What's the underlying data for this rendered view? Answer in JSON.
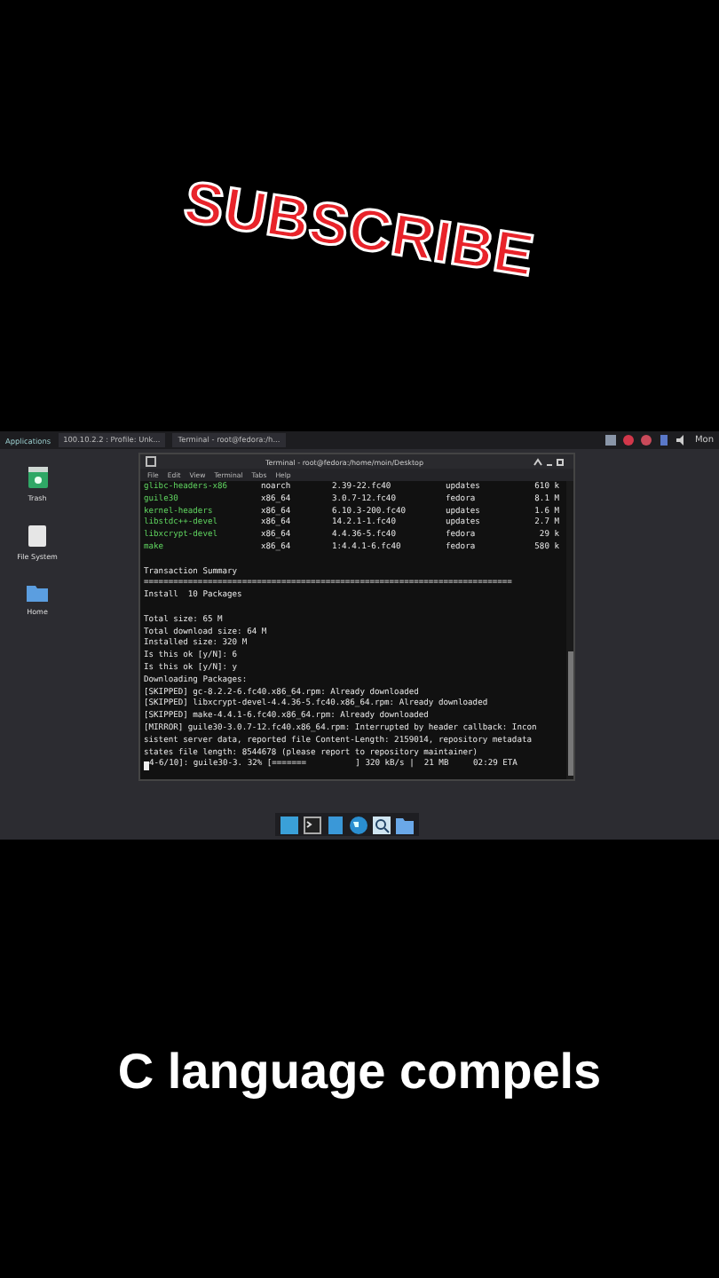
{
  "overlay": {
    "subscribe": "SUBSCRIBE"
  },
  "topbar": {
    "items": [
      {
        "kind": "menu",
        "label": "Applications"
      },
      {
        "kind": "task",
        "label": "100.10.2.2 : Profile: Unk..."
      },
      {
        "kind": "task",
        "label": "Terminal - root@fedora:/h..."
      }
    ],
    "day": "Mon"
  },
  "desktop": {
    "icons": [
      {
        "kind": "trash",
        "label": "Trash"
      },
      {
        "kind": "drive",
        "label": "File System"
      },
      {
        "kind": "folder",
        "label": "Home"
      }
    ]
  },
  "terminal": {
    "title": "Terminal - root@fedora:/home/moin/Desktop",
    "menu": [
      "File",
      "Edit",
      "View",
      "Terminal",
      "Tabs",
      "Help"
    ],
    "packages": [
      {
        "name": "glibc-headers-x86",
        "arch": "noarch",
        "version": "2.39-22.fc40",
        "repo": "updates",
        "size": "610 k"
      },
      {
        "name": "guile30",
        "arch": "x86_64",
        "version": "3.0.7-12.fc40",
        "repo": "fedora",
        "size": "8.1 M"
      },
      {
        "name": "kernel-headers",
        "arch": "x86_64",
        "version": "6.10.3-200.fc40",
        "repo": "updates",
        "size": "1.6 M"
      },
      {
        "name": "libstdc++-devel",
        "arch": "x86_64",
        "version": "14.2.1-1.fc40",
        "repo": "updates",
        "size": "2.7 M"
      },
      {
        "name": "libxcrypt-devel",
        "arch": "x86_64",
        "version": "4.4.36-5.fc40",
        "repo": "fedora",
        "size": "29 k"
      },
      {
        "name": "make",
        "arch": "x86_64",
        "version": "1:4.4.1-6.fc40",
        "repo": "fedora",
        "size": "580 k"
      }
    ],
    "lines": [
      {
        "kind": "blank"
      },
      {
        "kind": "text",
        "text": "Transaction Summary"
      },
      {
        "kind": "text",
        "text": "==========================================================================="
      },
      {
        "kind": "text",
        "text": "Install  10 Packages"
      },
      {
        "kind": "blank"
      },
      {
        "kind": "text",
        "text": "Total size: 65 M"
      },
      {
        "kind": "text",
        "text": "Total download size: 64 M"
      },
      {
        "kind": "text",
        "text": "Installed size: 320 M"
      },
      {
        "kind": "text",
        "text": "Is this ok [y/N]: 6"
      },
      {
        "kind": "text",
        "text": "Is this ok [y/N]: y"
      },
      {
        "kind": "text",
        "text": "Downloading Packages:"
      },
      {
        "kind": "text",
        "text": "[SKIPPED] gc-8.2.2-6.fc40.x86_64.rpm: Already downloaded"
      },
      {
        "kind": "text",
        "text": "[SKIPPED] libxcrypt-devel-4.4.36-5.fc40.x86_64.rpm: Already downloaded"
      },
      {
        "kind": "text",
        "text": "[SKIPPED] make-4.4.1-6.fc40.x86_64.rpm: Already downloaded"
      },
      {
        "kind": "text",
        "text": "[MIRROR] guile30-3.0.7-12.fc40.x86_64.rpm: Interrupted by header callback: Incon"
      },
      {
        "kind": "text",
        "text": "sistent server data, reported file Content-Length: 2159014, repository metadata"
      },
      {
        "kind": "text",
        "text": "states file length: 8544678 (please report to repository maintainer)"
      },
      {
        "kind": "prompt",
        "text": "4-6/10]: guile30-3. 32% [=======          ] 320 kB/s |  21 MB     02:29 ETA"
      }
    ]
  },
  "caption": "C language compels"
}
